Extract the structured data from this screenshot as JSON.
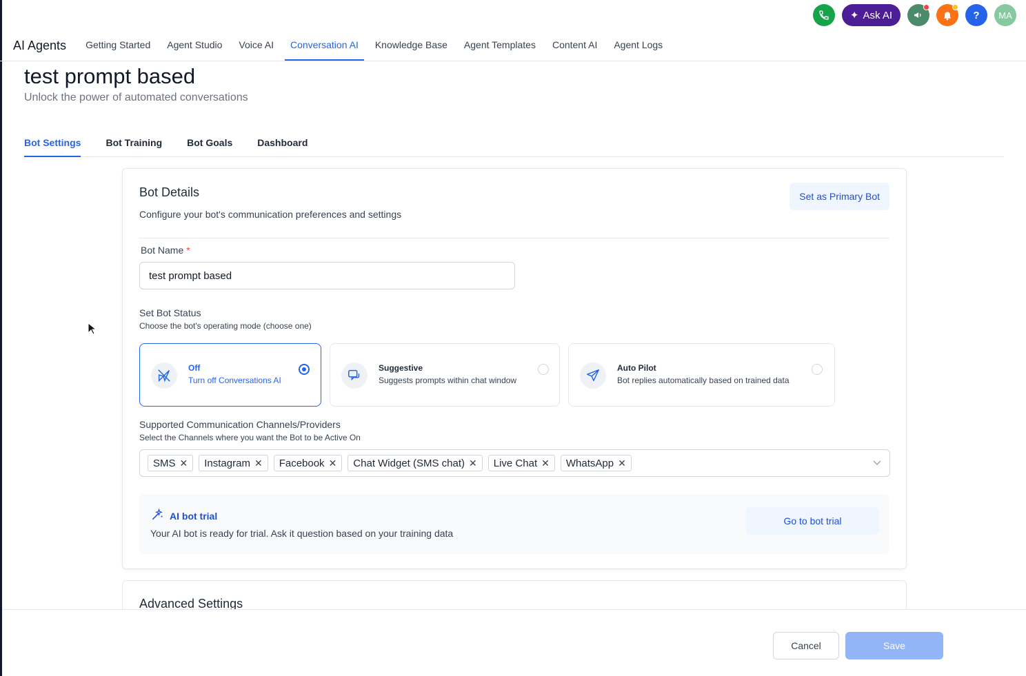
{
  "top_bar": {
    "ask_ai_label": "Ask AI",
    "help_label": "?",
    "avatar_initials": "MA"
  },
  "nav": {
    "app_title": "AI Agents",
    "items": [
      "Getting Started",
      "Agent Studio",
      "Voice AI",
      "Conversation AI",
      "Knowledge Base",
      "Agent Templates",
      "Content AI",
      "Agent Logs"
    ],
    "active": "Conversation AI"
  },
  "page": {
    "title": "test prompt based",
    "subtitle": "Unlock the power of automated conversations"
  },
  "subtabs": {
    "items": [
      "Bot Settings",
      "Bot Training",
      "Bot Goals",
      "Dashboard"
    ],
    "active": "Bot Settings"
  },
  "bot_details": {
    "title": "Bot Details",
    "description": "Configure your bot's communication preferences and settings",
    "primary_button": "Set as Primary Bot",
    "bot_name_label": "Bot Name",
    "required_mark": "*",
    "bot_name_value": "test prompt based",
    "status_label": "Set Bot Status",
    "status_hint": "Choose the bot's operating mode (choose one)",
    "modes": [
      {
        "title": "Off",
        "desc": "Turn off Conversations AI",
        "selected": true
      },
      {
        "title": "Suggestive",
        "desc": "Suggests prompts within chat window",
        "selected": false
      },
      {
        "title": "Auto Pilot",
        "desc": "Bot replies automatically based on trained data",
        "selected": false
      }
    ],
    "channels_label": "Supported Communication Channels/Providers",
    "channels_hint": "Select the Channels where you want the Bot to be Active On",
    "channels": [
      "SMS",
      "Instagram",
      "Facebook",
      "Chat Widget (SMS chat)",
      "Live Chat",
      "WhatsApp"
    ],
    "trial_title": "AI bot trial",
    "trial_desc": "Your AI bot is ready for trial. Ask it question based on your training data",
    "trial_button": "Go to bot trial"
  },
  "advanced": {
    "title": "Advanced Settings"
  },
  "footer": {
    "cancel": "Cancel",
    "save": "Save"
  },
  "colors": {
    "accent": "#2563eb",
    "ask_ai_bg": "#4c1d95",
    "save_disabled": "#93b4f6"
  }
}
